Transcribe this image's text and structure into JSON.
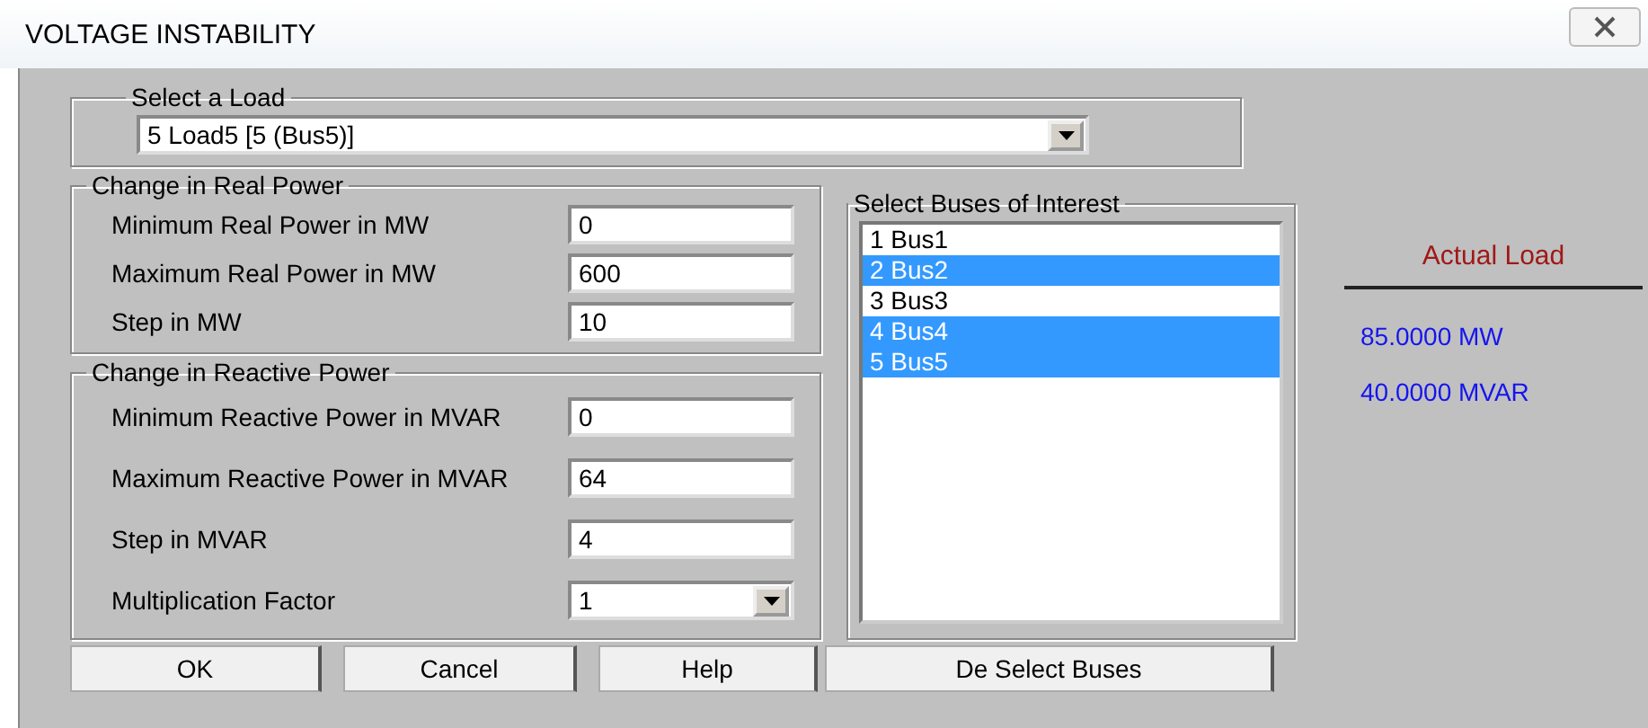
{
  "window": {
    "title": "VOLTAGE INSTABILITY"
  },
  "load_group": {
    "title": "Select a Load",
    "value": "5  Load5 [5 (Bus5)]"
  },
  "real_power": {
    "title": "Change in Real Power",
    "fields": [
      {
        "label": "Minimum Real Power in MW",
        "value": "0"
      },
      {
        "label": "Maximum Real Power in MW",
        "value": "600"
      },
      {
        "label": "Step in MW",
        "value": "10"
      }
    ]
  },
  "reactive_power": {
    "title": "Change in Reactive Power",
    "fields": [
      {
        "kind": "text",
        "label": "Minimum Reactive Power in MVAR",
        "value": "0"
      },
      {
        "kind": "text",
        "label": "Maximum Reactive Power in MVAR",
        "value": "64"
      },
      {
        "kind": "text",
        "label": "Step in MVAR",
        "value": "4"
      },
      {
        "kind": "dropdown",
        "label": "Multiplication Factor",
        "value": "1"
      }
    ]
  },
  "buses": {
    "title": "Select Buses of Interest",
    "items": [
      {
        "label": "1  Bus1",
        "selected": false
      },
      {
        "label": "2  Bus2",
        "selected": true
      },
      {
        "label": "3  Bus3",
        "selected": false
      },
      {
        "label": "4  Bus4",
        "selected": true
      },
      {
        "label": "5  Bus5",
        "selected": true
      }
    ]
  },
  "actual_load": {
    "title": "Actual Load",
    "values": [
      "85.0000 MW",
      "40.0000 MVAR"
    ]
  },
  "buttons": [
    "OK",
    "Cancel",
    "Help",
    "De Select Buses"
  ]
}
